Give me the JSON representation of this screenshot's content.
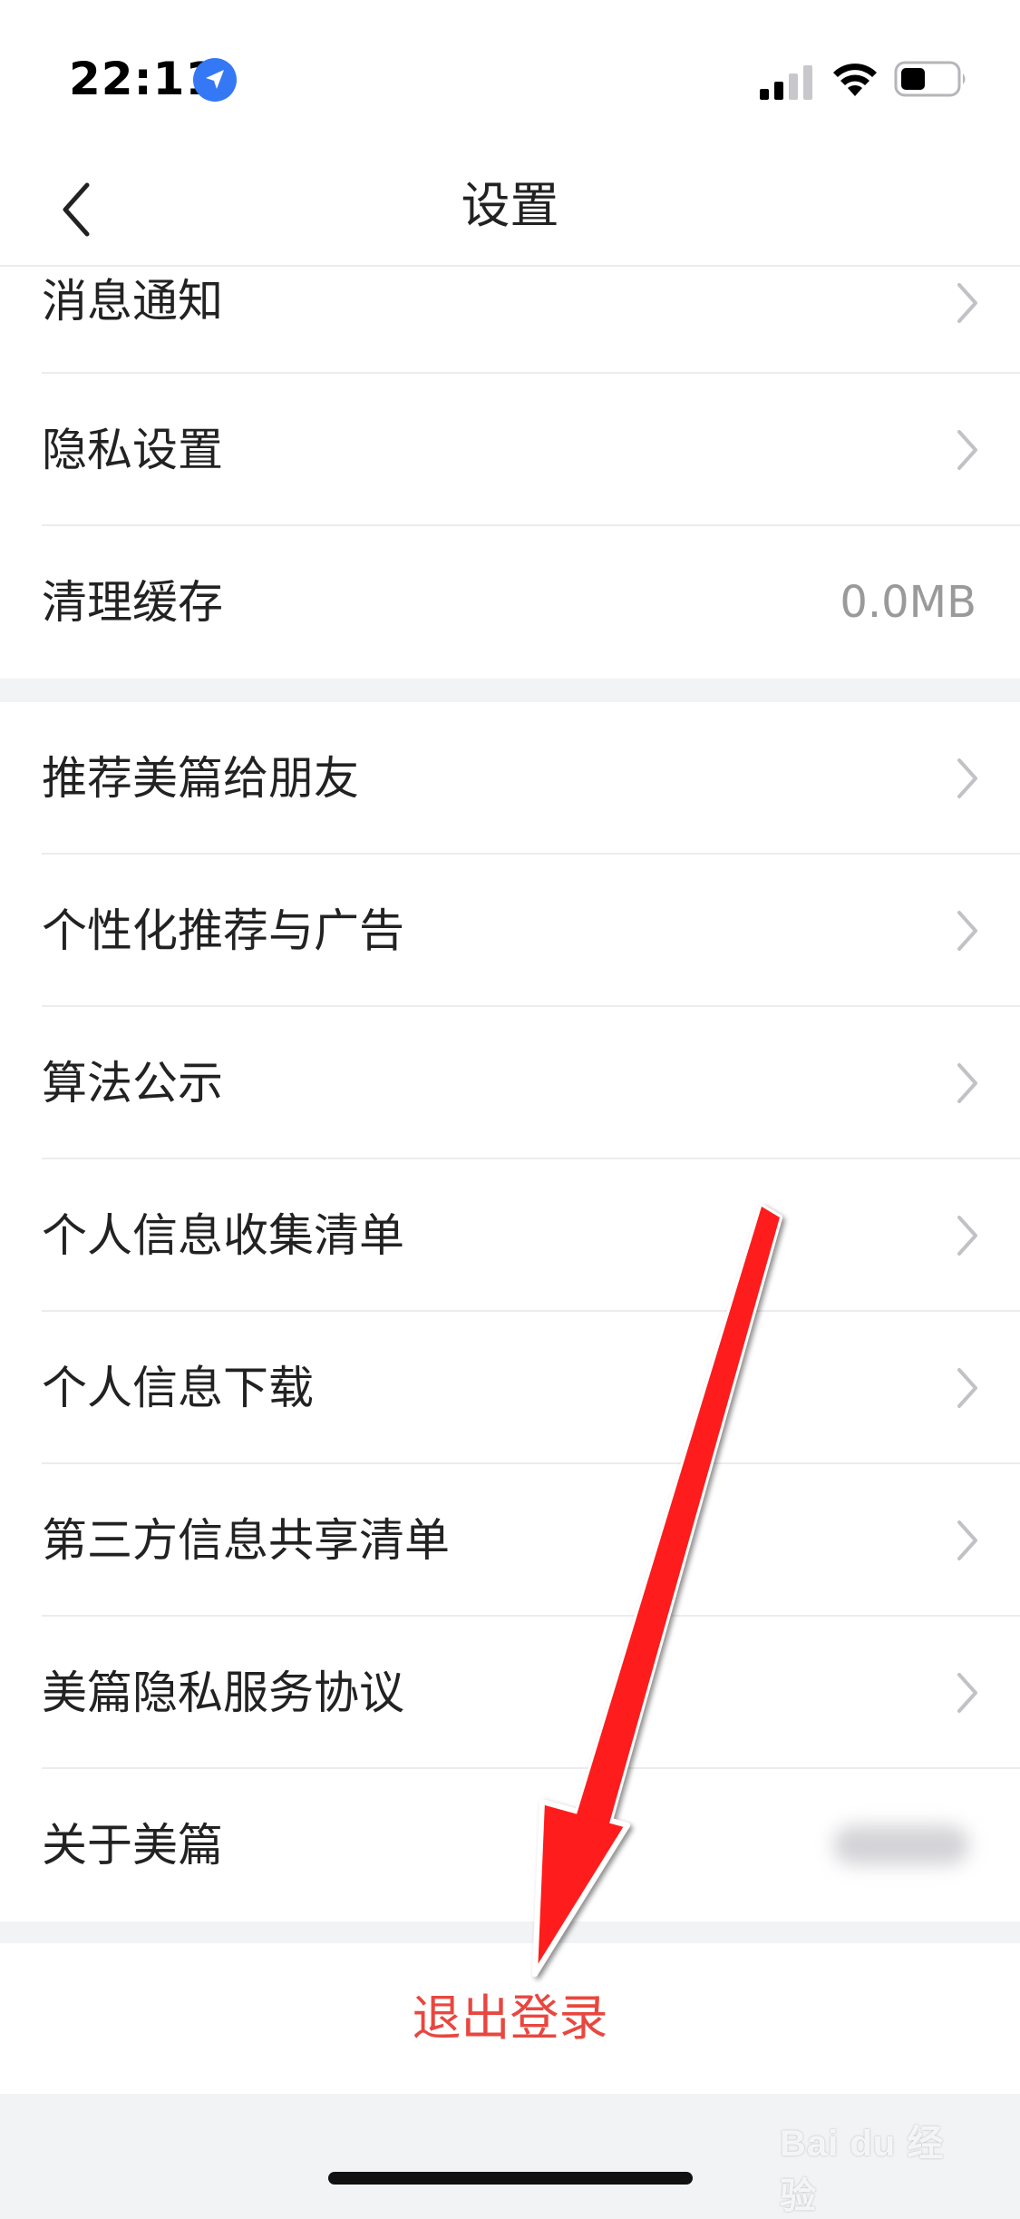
{
  "status_bar": {
    "time": "22:11",
    "icons": [
      "location-arrow-icon",
      "cellular-signal-icon",
      "wifi-icon",
      "battery-icon"
    ]
  },
  "nav": {
    "title": "设置",
    "back_icon": "chevron-left-icon"
  },
  "group1": [
    {
      "label": "消息通知",
      "chevron": true
    },
    {
      "label": "隐私设置",
      "chevron": true
    },
    {
      "label": "清理缓存",
      "value": "0.0MB"
    }
  ],
  "group2": [
    {
      "label": "推荐美篇给朋友",
      "chevron": true
    },
    {
      "label": "个性化推荐与广告",
      "chevron": true
    },
    {
      "label": "算法公示",
      "chevron": true
    },
    {
      "label": "个人信息收集清单",
      "chevron": true
    },
    {
      "label": "个人信息下载",
      "chevron": true
    },
    {
      "label": "第三方信息共享清单",
      "chevron": true
    },
    {
      "label": "美篇隐私服务协议",
      "chevron": true
    },
    {
      "label": "关于美篇",
      "blurred_value": true
    }
  ],
  "logout": {
    "label": "退出登录"
  },
  "colors": {
    "accent_red": "#e8473f",
    "background": "#f2f3f5",
    "annotation_arrow": "#ff0000"
  },
  "watermark": {
    "text": "Bai du 经验"
  }
}
